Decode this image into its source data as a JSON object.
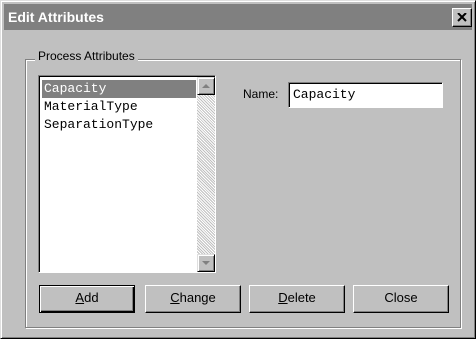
{
  "window": {
    "title": "Edit Attributes",
    "close_icon": "close-icon"
  },
  "group": {
    "label": "Process Attributes"
  },
  "list": {
    "items": [
      {
        "label": "Capacity",
        "selected": true
      },
      {
        "label": "MaterialType",
        "selected": false
      },
      {
        "label": "SeparationType",
        "selected": false
      }
    ]
  },
  "name_field": {
    "label": "Name:",
    "value": "Capacity"
  },
  "buttons": {
    "add": {
      "mnemonic": "A",
      "rest": "dd"
    },
    "change": {
      "mnemonic": "C",
      "rest": "hange"
    },
    "delete": {
      "mnemonic": "D",
      "rest": "elete"
    },
    "close": {
      "label": "Close"
    }
  },
  "colors": {
    "face": "#c0c0c0",
    "title_inactive": "#808080",
    "selection": "#808080"
  }
}
